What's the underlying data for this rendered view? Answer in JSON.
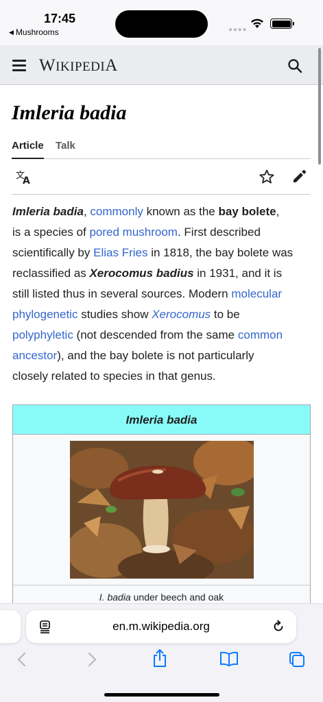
{
  "status_bar": {
    "time": "17:45",
    "back_app_label": "Mushrooms",
    "icons": [
      "signal-dots-icon",
      "wifi-icon",
      "battery-icon"
    ]
  },
  "header": {
    "wordmark_first": "W",
    "wordmark_rest": "IKIPEDI",
    "wordmark_last": "A",
    "icons": [
      "menu-icon",
      "search-icon"
    ]
  },
  "article": {
    "title": "Imleria badia",
    "tabs": [
      "Article",
      "Talk"
    ],
    "action_icons": [
      "translate-icon",
      "star-icon",
      "edit-pencil-icon"
    ],
    "lede": {
      "l1_a": "Imleria badia",
      "l1_b": ", ",
      "l1_link": "commonly",
      "l1_c": " known as the ",
      "l1_d": "bay bolete",
      "l1_e": ",",
      "l2_a": "is a species of ",
      "l2_link": "pored mushroom",
      "l2_b": ". First described",
      "l3_a": "scientifically by ",
      "l3_link": "Elias Fries",
      "l3_b": " in 1818, the bay bolete was",
      "l4_a": "reclassified as ",
      "l4_b": "Xerocomus badius",
      "l4_c": " in 1931, and it is",
      "l5_a": "still listed thus in several sources. Modern ",
      "l5_link": "molecular",
      "l6_link": "phylogenetic",
      "l6_a": " studies show ",
      "l6_link2": "Xerocomus",
      "l6_b": " to be",
      "l7_link": "polyphyletic",
      "l7_a": " (not descended from the same ",
      "l7_link2": "common",
      "l8_link": "ancestor",
      "l8_a": "), and the bay bolete is not particularly",
      "l9_a": "closely related to species in that genus."
    },
    "infobox": {
      "title": "Imleria badia",
      "caption_italic": "I. badia",
      "caption_rest": " under beech and oak",
      "header_color": "#88fbf9"
    }
  },
  "safari": {
    "url": "en.m.wikipedia.org",
    "icons": [
      "reader-icon",
      "reload-icon",
      "back-chevron-icon",
      "forward-chevron-icon",
      "share-icon",
      "bookmarks-icon",
      "tabs-icon"
    ]
  },
  "colors": {
    "link": "#3366cc",
    "safari_accent": "#0a7aff"
  }
}
